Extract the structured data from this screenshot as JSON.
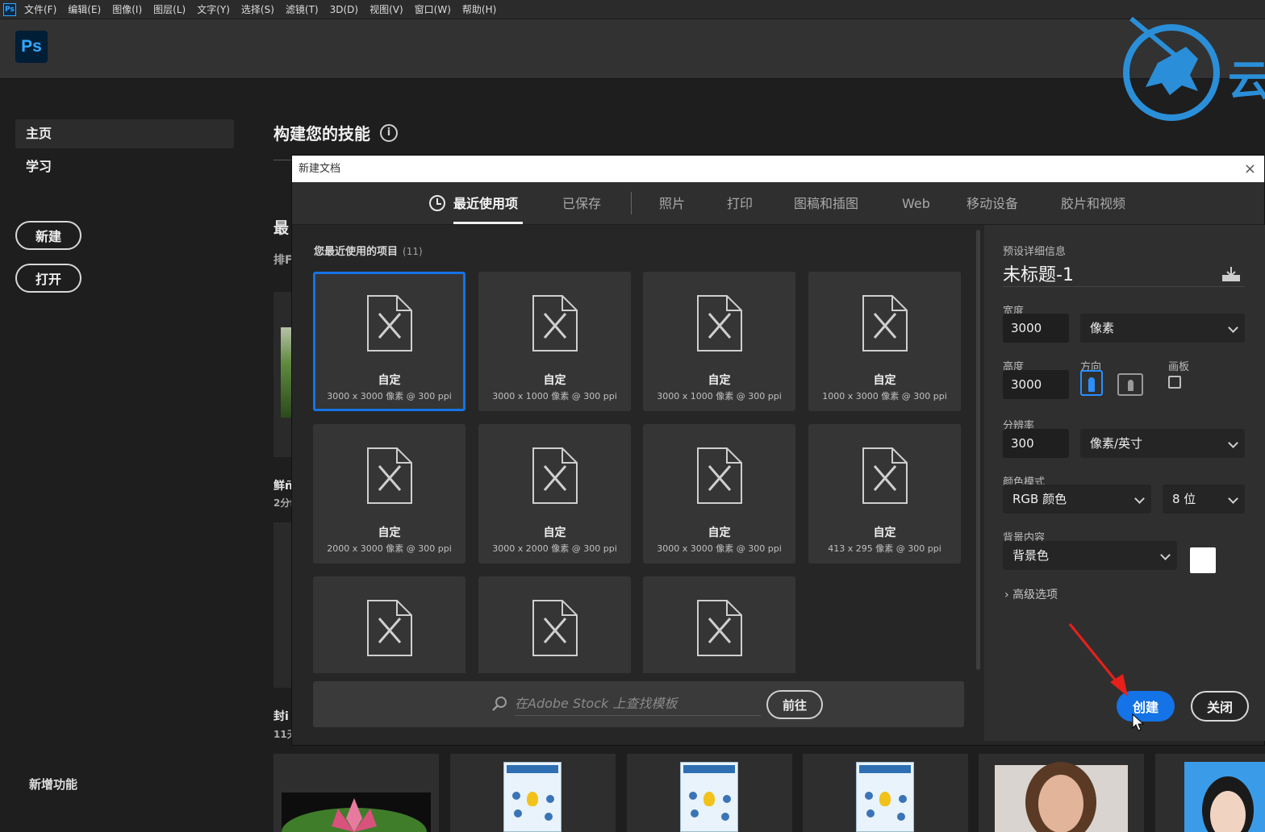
{
  "menubar": {
    "app_badge": "Ps",
    "items": [
      "文件(F)",
      "编辑(E)",
      "图像(I)",
      "图层(L)",
      "文字(Y)",
      "选择(S)",
      "滤镜(T)",
      "3D(D)",
      "视图(V)",
      "窗口(W)",
      "帮助(H)"
    ]
  },
  "topbar": {
    "logo": "Ps"
  },
  "watermark": {
    "text": "云",
    "color": "#2a8fd8"
  },
  "sidebar": {
    "items": [
      {
        "label": "主页",
        "active": true
      },
      {
        "label": "学习",
        "active": false
      }
    ],
    "new_button": "新建",
    "open_button": "打开",
    "footer": "新增功能"
  },
  "home": {
    "title": "构建您的技能",
    "info_icon": "i",
    "fragments": [
      "最",
      "排F",
      "鲜ñ",
      "2分f",
      "封i",
      "11天"
    ]
  },
  "dialog": {
    "title": "新建文档",
    "close_icon": "×",
    "tabs": [
      "最近使用项",
      "已保存",
      "照片",
      "打印",
      "图稿和插图",
      "Web",
      "移动设备",
      "胶片和视频"
    ],
    "active_tab": "最近使用项",
    "recent_heading": "您最近使用的项目",
    "recent_count": "(11)",
    "presets": [
      {
        "name": "自定",
        "size": "3000 x 3000 像素 @ 300 ppi",
        "selected": true
      },
      {
        "name": "自定",
        "size": "3000 x 1000 像素 @ 300 ppi",
        "selected": false
      },
      {
        "name": "自定",
        "size": "3000 x 1000 像素 @ 300 ppi",
        "selected": false
      },
      {
        "name": "自定",
        "size": "1000 x 3000 像素 @ 300 ppi",
        "selected": false
      },
      {
        "name": "自定",
        "size": "2000 x 3000 像素 @ 300 ppi",
        "selected": false
      },
      {
        "name": "自定",
        "size": "3000 x 2000 像素 @ 300 ppi",
        "selected": false
      },
      {
        "name": "自定",
        "size": "3000 x 3000 像素 @ 300 ppi",
        "selected": false
      },
      {
        "name": "自定",
        "size": "413 x 295 像素 @ 300 ppi",
        "selected": false
      }
    ],
    "stock_placeholder": "在Adobe Stock 上查找模板",
    "goto_button": "前往",
    "details": {
      "heading": "预设详细信息",
      "doc_name": "未标题-1",
      "width_label": "宽度",
      "width_value": "3000",
      "width_unit": "像素",
      "height_label": "高度",
      "height_value": "3000",
      "orientation_label": "方向",
      "artboard_label": "画板",
      "resolution_label": "分辨率",
      "resolution_value": "300",
      "resolution_unit": "像素/英寸",
      "color_mode_label": "颜色模式",
      "color_mode_value": "RGB 颜色",
      "bit_depth": "8 位",
      "background_label": "背景内容",
      "background_value": "背景色",
      "background_swatch": "#ffffff",
      "advanced": "高级选项"
    },
    "create_button": "创建",
    "close_button": "关闭"
  },
  "colors": {
    "accent": "#1473e6",
    "annotation_arrow": "#e8201a"
  }
}
